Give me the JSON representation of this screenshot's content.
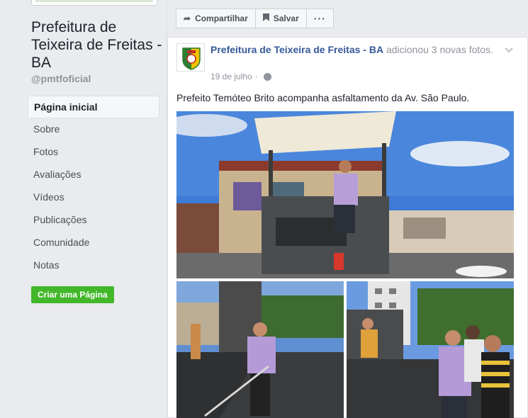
{
  "sidebar": {
    "page_name": "Prefeitura de Teixeira de Freitas - BA",
    "handle": "@pmtfoficial",
    "nav": [
      {
        "label": "Página inicial",
        "active": true
      },
      {
        "label": "Sobre"
      },
      {
        "label": "Fotos"
      },
      {
        "label": "Avaliações"
      },
      {
        "label": "Vídeos"
      },
      {
        "label": "Publicações"
      },
      {
        "label": "Comunidade"
      },
      {
        "label": "Notas"
      }
    ],
    "create_page_label": "Criar uma Página"
  },
  "actions": {
    "share_label": "Compartilhar",
    "save_label": "Salvar",
    "more_label": "···"
  },
  "post": {
    "author": "Prefeitura de Teixeira de Freitas - BA",
    "action_text": " adicionou 3 novas fotos.",
    "date": "19 de julho",
    "separator": "·",
    "text": "Prefeito Temóteo Brito acompanha asfaltamento da Av. São Paulo."
  },
  "colors": {
    "link": "#365899",
    "create_button": "#42b72a",
    "background": "#e9ebee"
  },
  "icons": [
    "share-icon",
    "bookmark-icon",
    "more-icon",
    "chevron-down-icon",
    "globe-icon"
  ]
}
